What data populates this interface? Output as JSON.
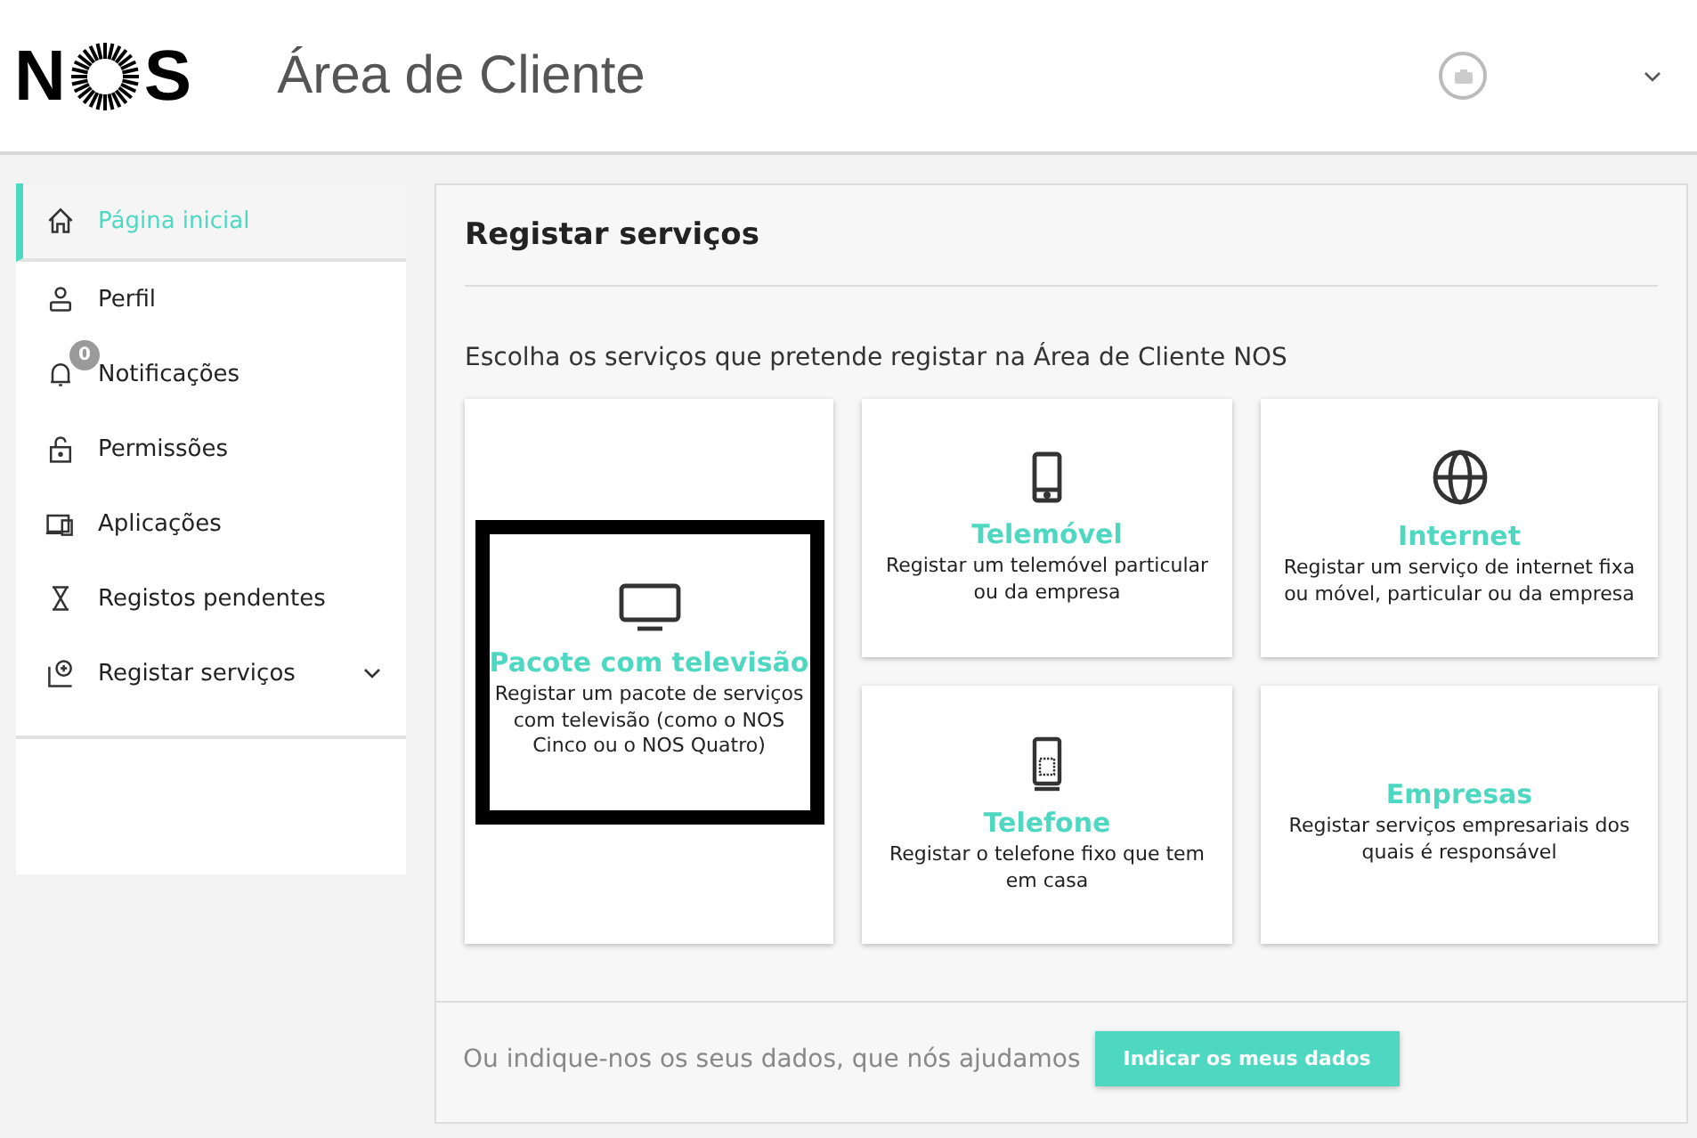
{
  "header": {
    "logo": {
      "left": "N",
      "right": "S"
    },
    "title": "Área de Cliente"
  },
  "sidebar": {
    "items": [
      {
        "label": "Página inicial",
        "kind": "home",
        "selected": true
      },
      {
        "label": "Perfil",
        "kind": "user",
        "selected": false
      },
      {
        "label": "Notificações",
        "kind": "bell",
        "selected": false,
        "badge": "0"
      },
      {
        "label": "Permissões",
        "kind": "lock",
        "selected": false
      },
      {
        "label": "Aplicações",
        "kind": "devices",
        "selected": false
      },
      {
        "label": "Registos pendentes",
        "kind": "hourglass",
        "selected": false
      },
      {
        "label": "Registar serviços",
        "kind": "add",
        "selected": false,
        "expanded": false
      }
    ]
  },
  "main": {
    "title": "Registar serviços",
    "subtitle": "Escolha os serviços que pretende registar na Área de Cliente NOS",
    "cards": [
      {
        "kind": "tv",
        "title": "Pacote com televisão",
        "description": "Registar um pacote de serviços com televisão (como o NOS Cinco ou o NOS Quatro)",
        "focused": true
      },
      {
        "kind": "mobile",
        "title": "Telemóvel",
        "description": "Registar um telemóvel particular ou da empresa",
        "focused": false
      },
      {
        "kind": "globe",
        "title": "Internet",
        "description": "Registar um serviço de internet fixa ou móvel, particular ou da empresa",
        "focused": false
      },
      {
        "kind": "phone",
        "title": "Telefone",
        "description": "Registar o telefone fixo que tem em casa",
        "focused": false
      },
      {
        "kind": "none",
        "title": "Empresas",
        "description": "Registar serviços empresariais dos quais é responsável",
        "focused": false
      }
    ],
    "footer": {
      "text": "Ou indique-nos os seus dados, que nós ajudamos",
      "button": "Indicar os meus dados"
    }
  }
}
